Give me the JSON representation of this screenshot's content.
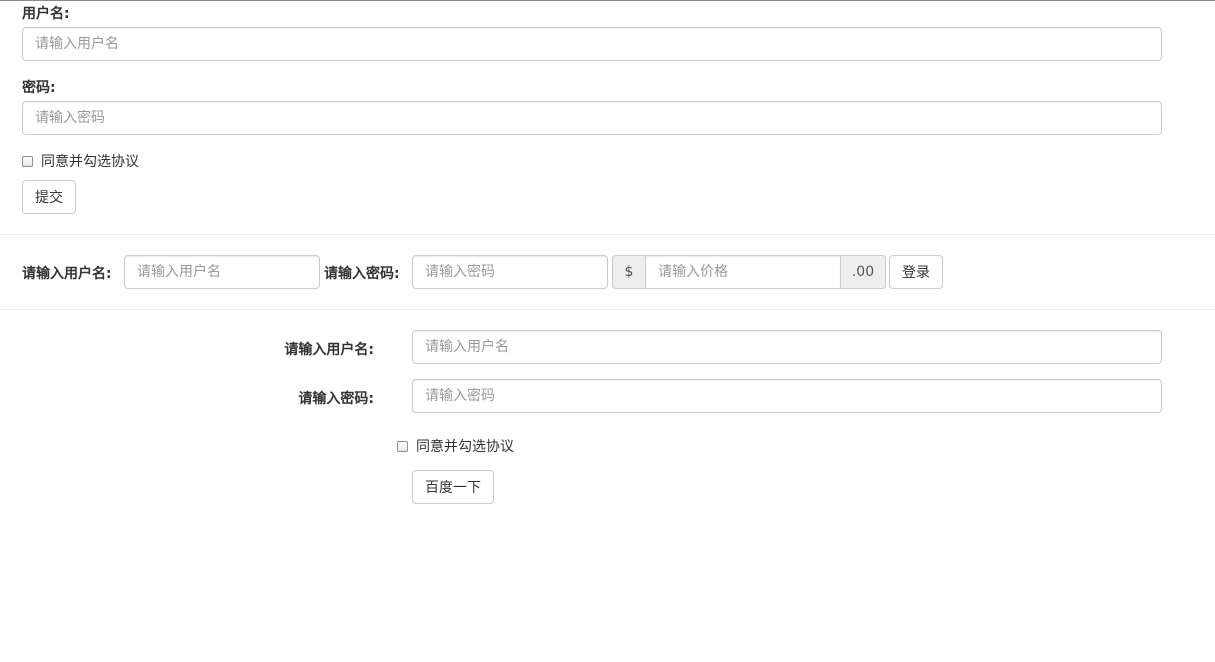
{
  "form1": {
    "username_label": "用户名:",
    "username_placeholder": "请输入用户名",
    "password_label": "密码:",
    "password_placeholder": "请输入密码",
    "agree_label": "同意并勾选协议",
    "submit_label": "提交"
  },
  "form2": {
    "username_label": "请输入用户名:",
    "username_placeholder": "请输入用户名",
    "password_label": "请输入密码:",
    "password_placeholder": "请输入密码",
    "currency_prefix": "$",
    "price_placeholder": "请输入价格",
    "price_suffix": ".00",
    "login_label": "登录"
  },
  "form3": {
    "username_label": "请输入用户名:",
    "username_placeholder": "请输入用户名",
    "password_label": "请输入密码:",
    "password_placeholder": "请输入密码",
    "agree_label": "同意并勾选协议",
    "submit_label": "百度一下"
  }
}
